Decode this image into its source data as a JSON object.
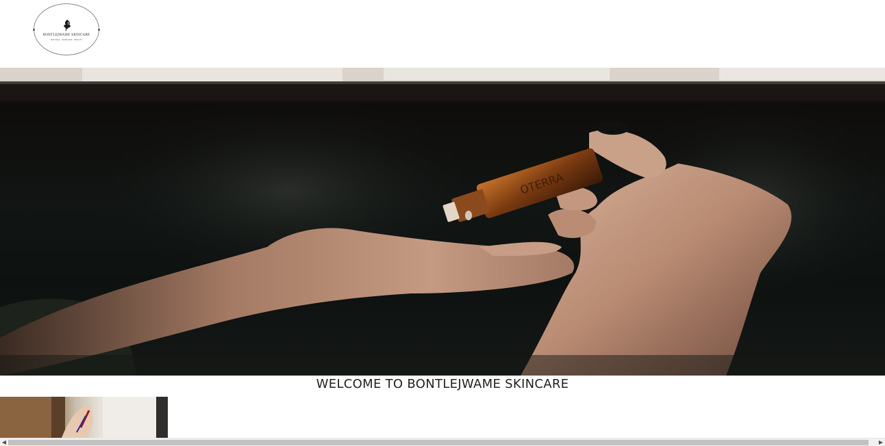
{
  "header": {
    "logo": {
      "icon": "flower-silhouette-icon",
      "brand_name": "BONTLEJWAME SKINCARE",
      "tagline": "NATURAL · SKINCARE · BEAUTY"
    }
  },
  "hero": {
    "image": "hand-dropping-oil-image"
  },
  "welcome": {
    "heading": "WELCOME TO BONTLEJWAME SKINCARE"
  },
  "thumbnail": {
    "image": "skincare-application-thumbnail"
  },
  "scrollbar": {
    "left_arrow": "◀",
    "right_arrow": "▶"
  },
  "colors": {
    "heading_text": "#222222",
    "background": "#ffffff",
    "scrollbar_thumb": "#c1c1c1"
  }
}
